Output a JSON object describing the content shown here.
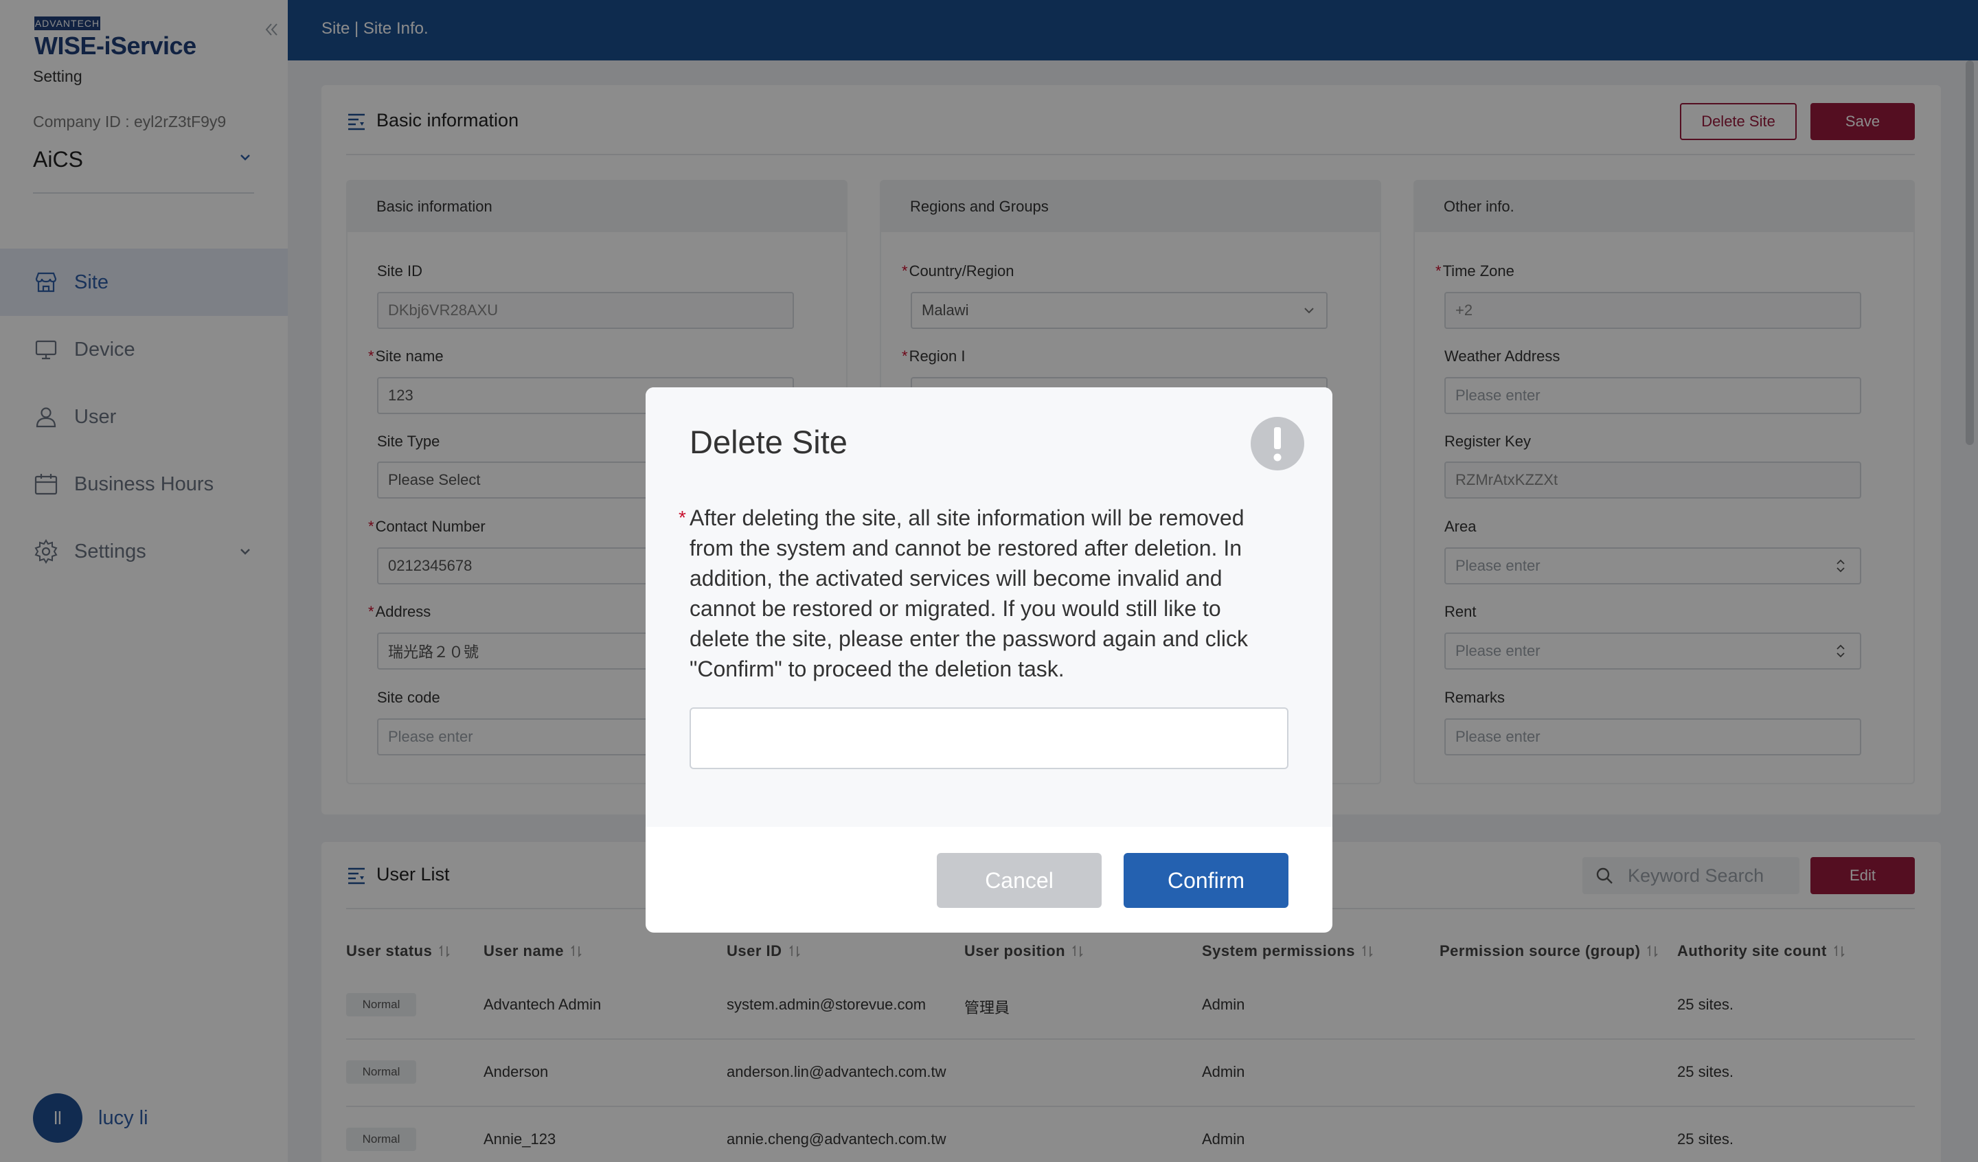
{
  "sidebar": {
    "brand_badge": "ADVANTECH",
    "brand_name": "WISE-iService",
    "brand_sub": "Setting",
    "company_id": "Company ID : eyl2rZ3tF9y9",
    "company_name": "AiCS",
    "items": [
      {
        "label": "Site",
        "icon": "store-icon",
        "active": true
      },
      {
        "label": "Device",
        "icon": "monitor-icon",
        "active": false
      },
      {
        "label": "User",
        "icon": "user-icon",
        "active": false
      },
      {
        "label": "Business Hours",
        "icon": "calendar-icon",
        "active": false
      },
      {
        "label": "Settings",
        "icon": "gear-icon",
        "active": false
      }
    ],
    "user_initials": "ll",
    "user_name": "lucy li"
  },
  "header": {
    "breadcrumb": "Site | Site Info."
  },
  "basic": {
    "title": "Basic information",
    "delete_label": "Delete Site",
    "save_label": "Save",
    "panels": {
      "basic": {
        "title": "Basic information",
        "site_id_label": "Site ID",
        "site_id_value": "DKbj6VR28AXU",
        "site_name_label": "Site name",
        "site_name_value": "123",
        "site_type_label": "Site Type",
        "site_type_value": "Please Select",
        "contact_label": "Contact Number",
        "contact_value": "0212345678",
        "address_label": "Address",
        "address_value": "瑞光路２０號",
        "site_code_label": "Site code",
        "site_code_placeholder": "Please enter"
      },
      "regions": {
        "title": "Regions and Groups",
        "country_label": "Country/Region",
        "country_value": "Malawi",
        "region_label": "Region I"
      },
      "other": {
        "title": "Other info.",
        "timezone_label": "Time Zone",
        "timezone_value": "+2",
        "weather_label": "Weather Address",
        "weather_placeholder": "Please enter",
        "register_label": "Register Key",
        "register_value": "RZMrAtxKZZXt",
        "area_label": "Area",
        "area_placeholder": "Please enter",
        "rent_label": "Rent",
        "rent_placeholder": "Please enter",
        "remarks_label": "Remarks",
        "remarks_placeholder": "Please enter"
      }
    }
  },
  "user_list": {
    "title": "User List",
    "search_placeholder": "Keyword Search",
    "edit_label": "Edit",
    "columns": [
      "User status",
      "User name",
      "User ID",
      "User position",
      "System permissions",
      "Permission source (group)",
      "Authority site count"
    ],
    "rows": [
      {
        "status": "Normal",
        "name": "Advantech Admin",
        "id": "system.admin@storevue.com",
        "position": "管理員",
        "permissions": "Admin",
        "source": "",
        "count": "25 sites."
      },
      {
        "status": "Normal",
        "name": "Anderson",
        "id": "anderson.lin@advantech.com.tw",
        "position": "",
        "permissions": "Admin",
        "source": "",
        "count": "25 sites."
      },
      {
        "status": "Normal",
        "name": "Annie_123",
        "id": "annie.cheng@advantech.com.tw",
        "position": "",
        "permissions": "Admin",
        "source": "",
        "count": "25 sites."
      }
    ]
  },
  "modal": {
    "title": "Delete Site",
    "message": "After deleting the site, all site information will be removed from the system and cannot be restored after deletion. In addition, the activated services will become invalid and cannot be restored or migrated. If you would still like to delete the site, please enter the password again and click \"Confirm\" to proceed the deletion task.",
    "password_value": "",
    "cancel_label": "Cancel",
    "confirm_label": "Confirm"
  }
}
